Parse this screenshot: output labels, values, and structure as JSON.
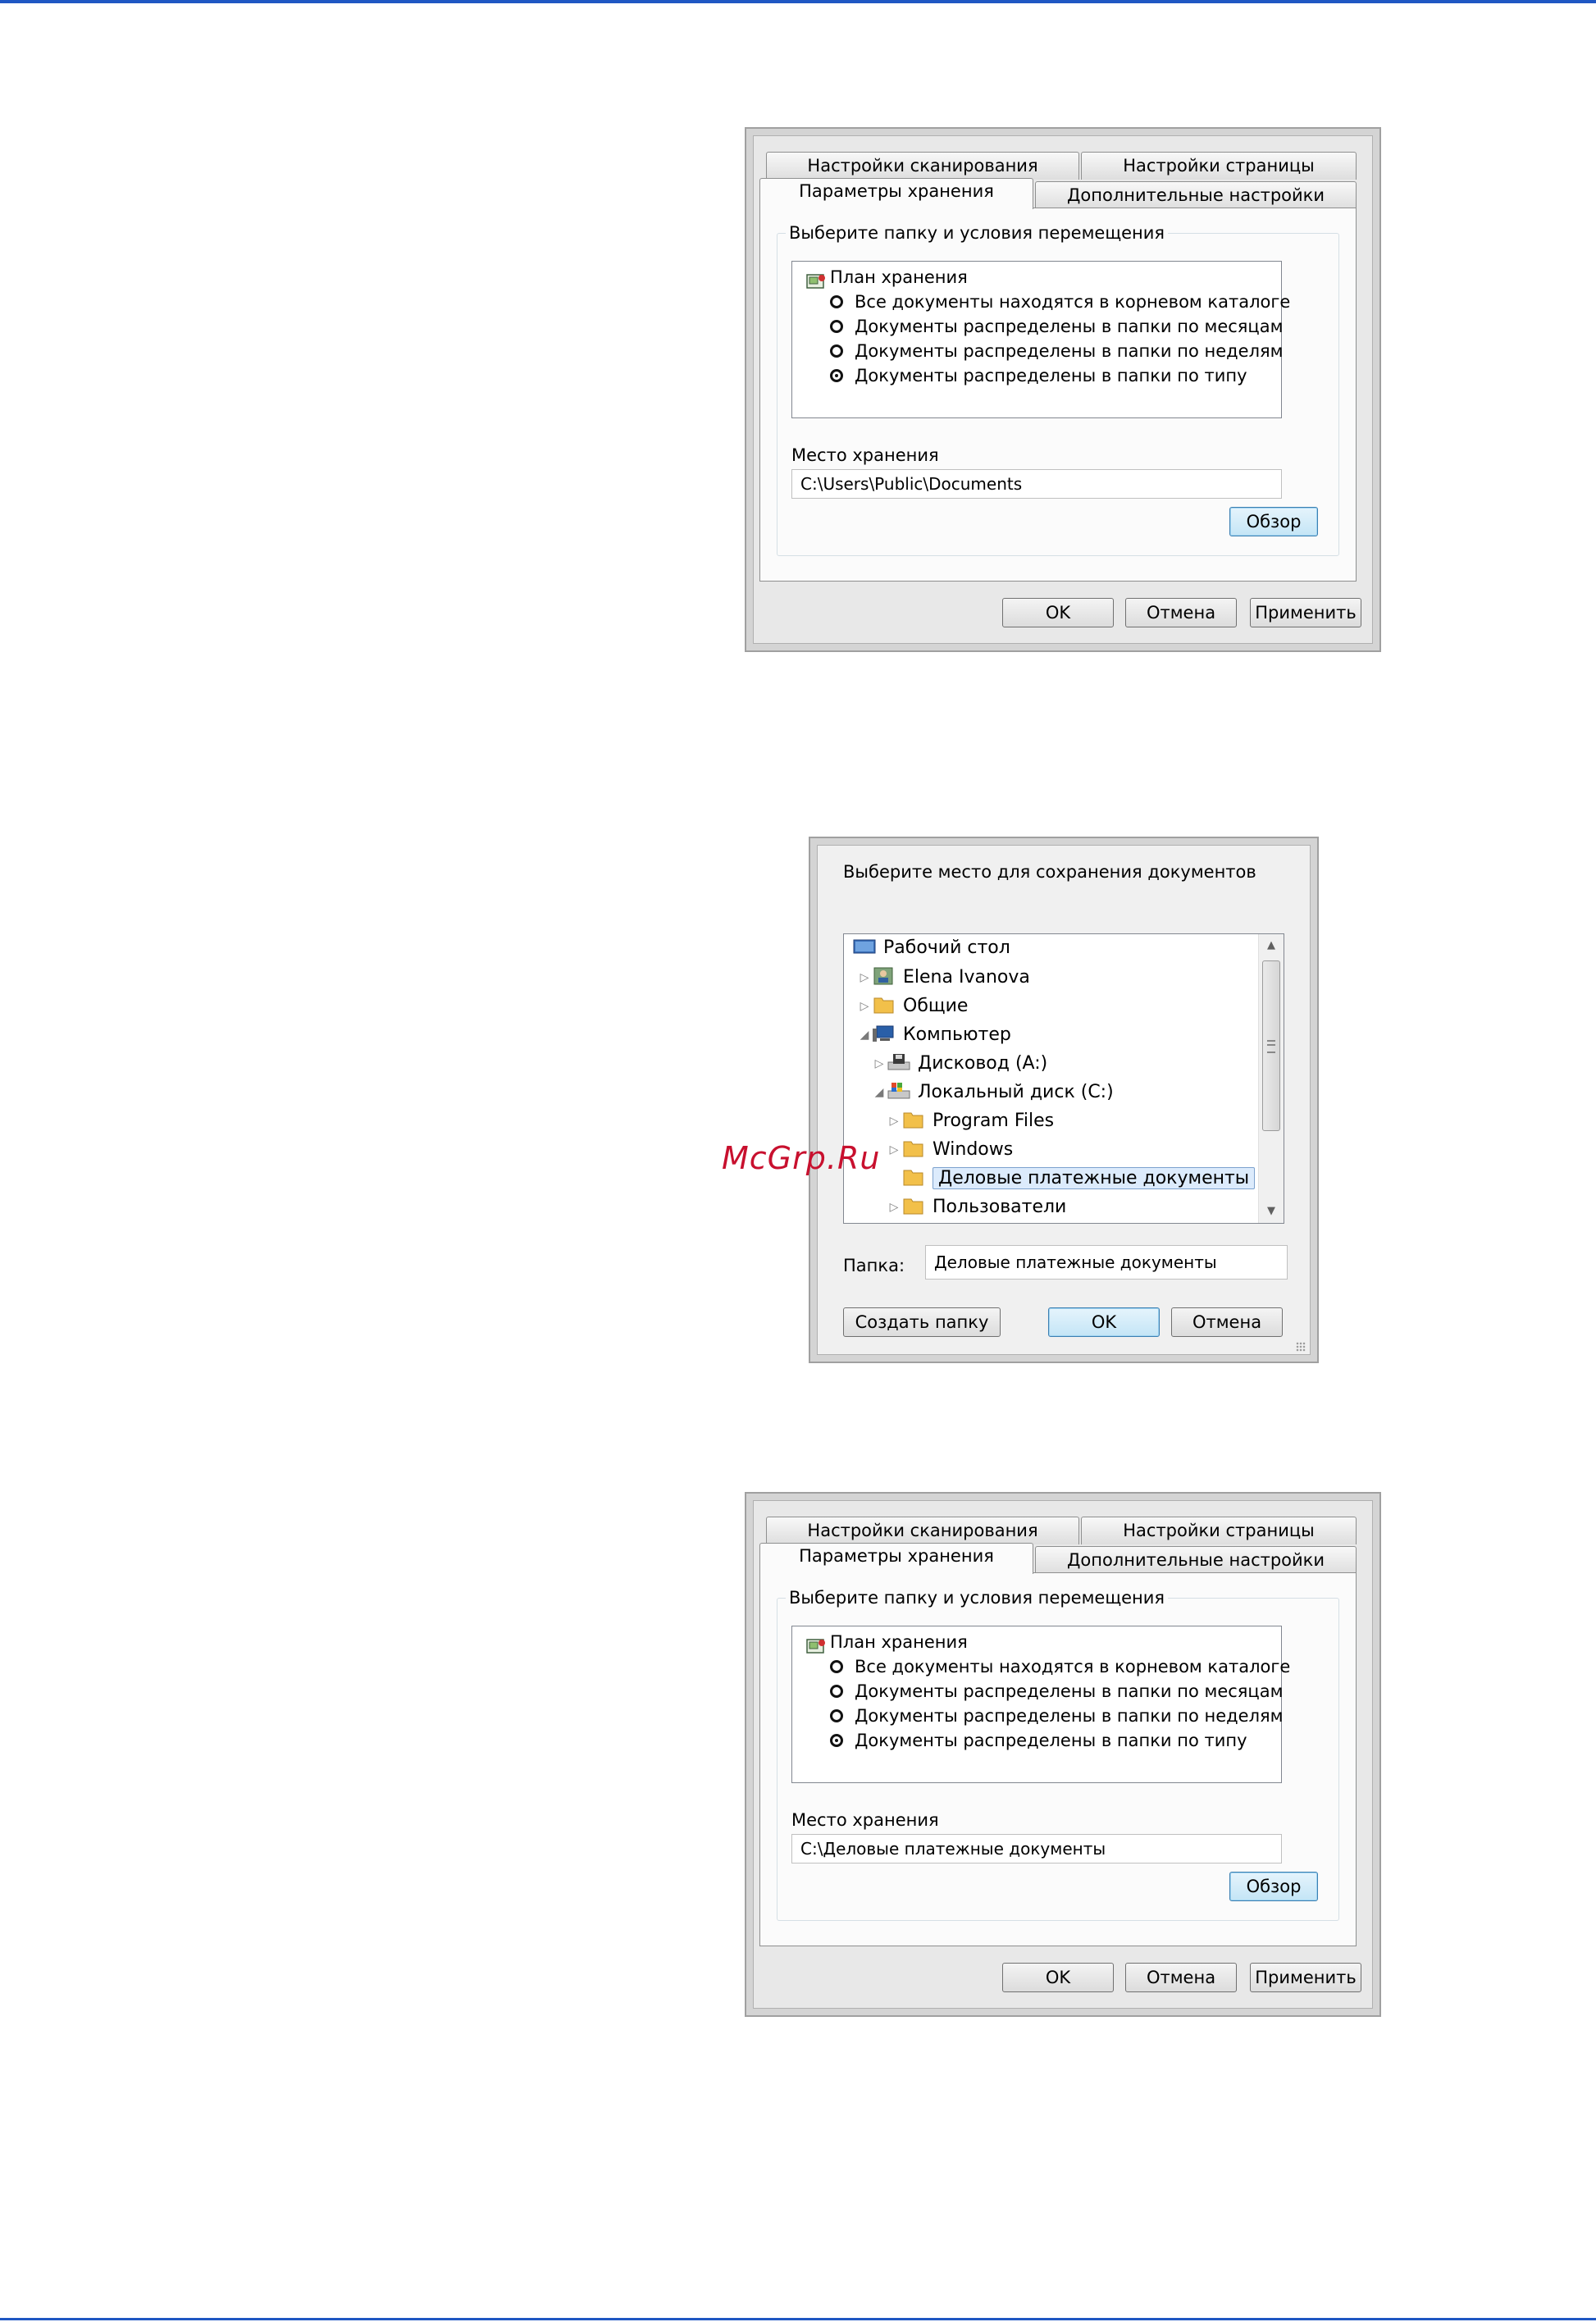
{
  "watermark": "McGrp.Ru",
  "settings_dialog_before": {
    "tabs": {
      "scan_settings": "Настройки сканирования",
      "page_settings": "Настройки страницы",
      "storage_options": "Параметры хранения",
      "advanced_settings": "Дополнительные настройки"
    },
    "group_title": "Выберите папку и условия перемещения",
    "plan_title": "План хранения",
    "options": [
      {
        "label": "Все документы находятся в корневом каталоге",
        "selected": false
      },
      {
        "label": "Документы распределены в папки по месяцам",
        "selected": false
      },
      {
        "label": "Документы распределены в папки по неделям",
        "selected": false
      },
      {
        "label": "Документы распределены в папки по типу",
        "selected": true
      }
    ],
    "location_label": "Место хранения",
    "location_value": "C:\\Users\\Public\\Documents",
    "browse_label": "Обзор",
    "ok_label": "OK",
    "cancel_label": "Отмена",
    "apply_label": "Применить"
  },
  "browse_dialog": {
    "title": "Выберите место для сохранения документов",
    "tree": [
      {
        "label": "Рабочий стол",
        "icon": "desktop-icon",
        "expander": ""
      },
      {
        "label": "Elena Ivanova",
        "icon": "user-folder-icon",
        "expander": "collapsed"
      },
      {
        "label": "Общие",
        "icon": "folder-icon",
        "expander": "collapsed"
      },
      {
        "label": "Компьютер",
        "icon": "computer-icon",
        "expander": "expanded"
      },
      {
        "label": "Дисковод (A:)",
        "icon": "floppy-drive-icon",
        "expander": "collapsed"
      },
      {
        "label": "Локальный диск (C:)",
        "icon": "local-disk-icon",
        "expander": "expanded"
      },
      {
        "label": "Program Files",
        "icon": "folder-icon",
        "expander": "collapsed"
      },
      {
        "label": "Windows",
        "icon": "folder-icon",
        "expander": "collapsed"
      },
      {
        "label": "Деловые платежные документы",
        "icon": "folder-icon",
        "expander": "",
        "selected": true
      },
      {
        "label": "Пользователи",
        "icon": "folder-icon",
        "expander": "collapsed"
      }
    ],
    "folder_label": "Папка:",
    "folder_value": "Деловые платежные документы",
    "new_folder_label": "Создать папку",
    "ok_label": "OK",
    "cancel_label": "Отмена"
  },
  "settings_dialog_after": {
    "tabs": {
      "scan_settings": "Настройки сканирования",
      "page_settings": "Настройки страницы",
      "storage_options": "Параметры хранения",
      "advanced_settings": "Дополнительные настройки"
    },
    "group_title": "Выберите папку и условия перемещения",
    "plan_title": "План хранения",
    "options": [
      {
        "label": "Все документы находятся в корневом каталоге",
        "selected": false
      },
      {
        "label": "Документы распределены в папки по месяцам",
        "selected": false
      },
      {
        "label": "Документы распределены в папки по неделям",
        "selected": false
      },
      {
        "label": "Документы распределены в папки по типу",
        "selected": true
      }
    ],
    "location_label": "Место хранения",
    "location_value": "C:\\Деловые платежные документы",
    "browse_label": "Обзор",
    "ok_label": "OK",
    "cancel_label": "Отмена",
    "apply_label": "Применить"
  }
}
